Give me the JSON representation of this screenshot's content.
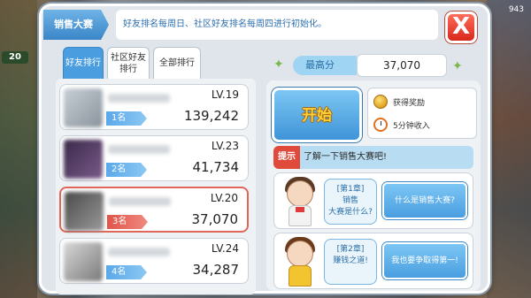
{
  "hud": {
    "level": "20",
    "coins": "943"
  },
  "dialog": {
    "title": "销售大赛",
    "notice": "好友排名每周日、社区好友排名每周四进行初始化。",
    "close_label": "X"
  },
  "tabs": [
    {
      "label": "好友排行",
      "active": true
    },
    {
      "label": "社区好友排行",
      "active": false
    },
    {
      "label": "全部排行",
      "active": false
    }
  ],
  "ranking": [
    {
      "level": "LV.19",
      "rank": "1名",
      "score": "139,242",
      "is_me": false
    },
    {
      "level": "LV.23",
      "rank": "2名",
      "score": "41,734",
      "is_me": false
    },
    {
      "level": "LV.20",
      "rank": "3名",
      "score": "37,070",
      "is_me": true
    },
    {
      "level": "LV.24",
      "rank": "4名",
      "score": "34,287",
      "is_me": false
    }
  ],
  "best": {
    "label": "最高分",
    "value": "37,070"
  },
  "start": {
    "label": "开始"
  },
  "rewards": [
    {
      "icon": "coin-icon",
      "label": "获得奖励"
    },
    {
      "icon": "clock-icon",
      "label": "5分钟收入"
    }
  ],
  "tip": {
    "tag": "提示",
    "text": "了解一下销售大赛吧!"
  },
  "chapters": [
    {
      "bubble": "[第1章]\n销售\n大赛是什么?",
      "action": "什么是销售大赛?"
    },
    {
      "bubble": "[第2章]\n赚钱之道!",
      "action": "我也要争取得第一!"
    }
  ]
}
